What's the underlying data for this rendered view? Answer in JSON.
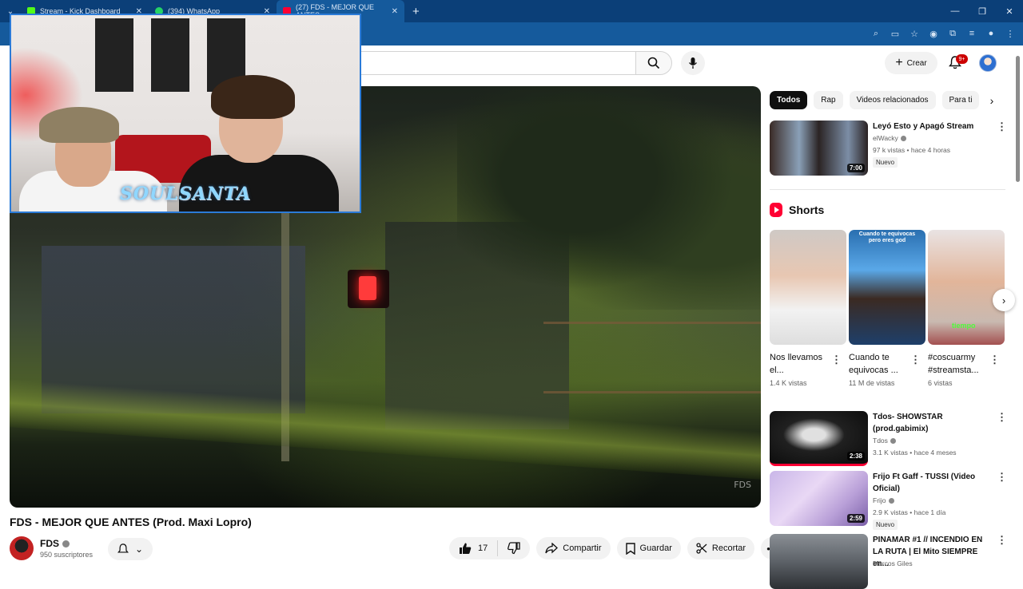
{
  "browser": {
    "tabs": [
      {
        "label": "Stream - Kick Dashboard",
        "color": "#53fc18"
      },
      {
        "label": "(394) WhatsApp",
        "color": "#25d366"
      },
      {
        "label": "(27) FDS - MEJOR QUE ANTES",
        "color": "#ff0033"
      }
    ],
    "new_tab": "+",
    "window_controls": [
      "—",
      "❐",
      "✕"
    ]
  },
  "masthead": {
    "create_label": "Crear",
    "notifications_badge": "9+"
  },
  "video": {
    "title": "FDS - MEJOR QUE ANTES (Prod. Maxi Lopro)",
    "watermark": "FDS",
    "overlay_logo": "SOULSANTA",
    "channel": {
      "name": "FDS",
      "subscribers": "950 suscriptores"
    },
    "likes": "17",
    "share_label": "Compartir",
    "save_label": "Guardar",
    "clip_label": "Recortar"
  },
  "sidebar": {
    "chips": [
      "Todos",
      "Rap",
      "Videos relacionados",
      "Para ti"
    ],
    "top_recommendation": {
      "title": "Leyó Esto y Apagó Stream",
      "channel": "elWacky",
      "meta": "97 k vistas • hace 4 horas",
      "duration": "7:00",
      "badge": "Nuevo"
    },
    "shorts_title": "Shorts",
    "shorts": [
      {
        "title": "Nos llevamos el...",
        "views": "1.4 K vistas"
      },
      {
        "title": "Cuando te equivocas ...",
        "views": "11 M de vistas",
        "overlay": "Cuando te equivocas pero eres god"
      },
      {
        "title": "#coscuarmy #streamsta...",
        "views": "6 vistas",
        "overlay": "tiempo"
      }
    ],
    "recommendations": [
      {
        "title": "Tdos- SHOWSTAR (prod.gabimix)",
        "channel": "Tdos",
        "meta": "3.1 K vistas • hace 4 meses",
        "duration": "2:38"
      },
      {
        "title": "Frijo Ft Gaff - TUSSI (Video Oficial)",
        "channel": "Frijo",
        "meta": "2.9 K vistas • hace 1 día",
        "duration": "2:59",
        "badge": "Nuevo"
      },
      {
        "title": "PINAMAR #1 // INCENDIO EN LA RUTA | El Mito SIEMPRE en...",
        "channel": "Marcos Giles",
        "meta": ""
      }
    ]
  }
}
